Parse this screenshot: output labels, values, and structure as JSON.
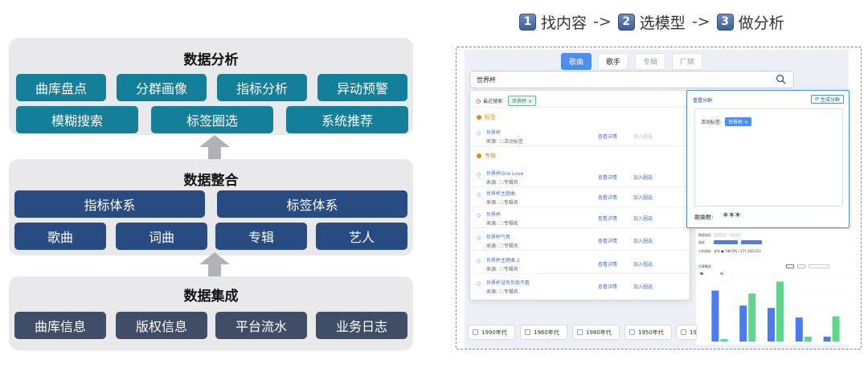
{
  "architecture": {
    "analysis": {
      "title": "数据分析",
      "row1": [
        "曲库盘点",
        "分群画像",
        "指标分析",
        "异动预警"
      ],
      "row2": [
        "模糊搜索",
        "标签圈选",
        "系统推荐"
      ]
    },
    "integration": {
      "title": "数据整合",
      "row1": [
        "指标体系",
        "标签体系"
      ],
      "row2": [
        "歌曲",
        "词曲",
        "专辑",
        "艺人"
      ]
    },
    "collection": {
      "title": "数据集成",
      "row1": [
        "曲库信息",
        "版权信息",
        "平台流水",
        "业务日志"
      ]
    }
  },
  "steps": [
    {
      "num": "1",
      "label": "找内容",
      "arrow": "->"
    },
    {
      "num": "2",
      "label": "选模型",
      "arrow": "->"
    },
    {
      "num": "3",
      "label": "做分析",
      "arrow": ""
    }
  ],
  "search_ui": {
    "tabs": [
      "歌曲",
      "歌手",
      "专辑",
      "厂牌"
    ],
    "query": "世界杯",
    "recent_label": "最近搜索:",
    "recent_tag": "世界杯 ×",
    "section_tag": "标签",
    "section_album": "专辑",
    "detail_label": "查看详情",
    "add_label": "加入圈选",
    "results_tag": [
      {
        "name": "世界杯",
        "source": "来源: 🗀活动标签"
      }
    ],
    "results_album": [
      {
        "name": "世界杯One Love",
        "source": "来源: 🗀专辑名"
      },
      {
        "name": "世界杯主题曲",
        "source": "来源: 🗀专辑名"
      },
      {
        "name": "世界杯",
        "source": "来源: 🗀专辑名"
      },
      {
        "name": "世界杯气氛",
        "source": "来源: 🗀专辑名"
      },
      {
        "name": "世界杯主题曲 2",
        "source": "来源: 🗀专辑名"
      },
      {
        "name": "世界杯没有你我不看",
        "source": "来源: 🗀专辑名"
      }
    ],
    "decades": [
      "1990年代",
      "1960年代",
      "1980年代",
      "1950年代",
      "1970年代"
    ]
  },
  "cluster_panel": {
    "title": "重置分群",
    "generate_button": "生成分群",
    "active_label": "活动标签:",
    "active_tag": "世界杯 ×",
    "count_label": "歌曲数:",
    "count_value": "***"
  },
  "dashboard": {
    "row_labels": [
      "数据指标",
      "维度",
      "分析指标"
    ],
    "value_text": "全年 ● 196.0% / 177,343,123",
    "title": "分享概况",
    "chart_data": {
      "type": "bar",
      "categories": [
        "A",
        "B",
        "C",
        "D",
        "E"
      ],
      "series": [
        {
          "values": [
            85,
            60,
            56,
            40,
            8
          ]
        },
        {
          "values": [
            4,
            80,
            100,
            8,
            42
          ]
        }
      ],
      "ylim": [
        0,
        110
      ],
      "colors": [
        "#4a7bef",
        "#5fd68e"
      ]
    }
  }
}
